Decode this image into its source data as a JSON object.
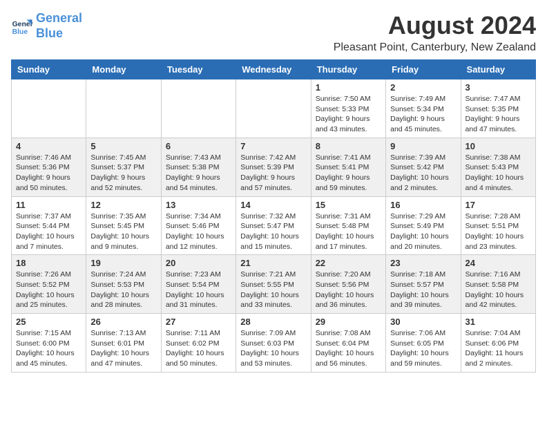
{
  "header": {
    "logo_line1": "General",
    "logo_line2": "Blue",
    "month_year": "August 2024",
    "location": "Pleasant Point, Canterbury, New Zealand"
  },
  "weekdays": [
    "Sunday",
    "Monday",
    "Tuesday",
    "Wednesday",
    "Thursday",
    "Friday",
    "Saturday"
  ],
  "weeks": [
    [
      {
        "day": "",
        "info": ""
      },
      {
        "day": "",
        "info": ""
      },
      {
        "day": "",
        "info": ""
      },
      {
        "day": "",
        "info": ""
      },
      {
        "day": "1",
        "info": "Sunrise: 7:50 AM\nSunset: 5:33 PM\nDaylight: 9 hours\nand 43 minutes."
      },
      {
        "day": "2",
        "info": "Sunrise: 7:49 AM\nSunset: 5:34 PM\nDaylight: 9 hours\nand 45 minutes."
      },
      {
        "day": "3",
        "info": "Sunrise: 7:47 AM\nSunset: 5:35 PM\nDaylight: 9 hours\nand 47 minutes."
      }
    ],
    [
      {
        "day": "4",
        "info": "Sunrise: 7:46 AM\nSunset: 5:36 PM\nDaylight: 9 hours\nand 50 minutes."
      },
      {
        "day": "5",
        "info": "Sunrise: 7:45 AM\nSunset: 5:37 PM\nDaylight: 9 hours\nand 52 minutes."
      },
      {
        "day": "6",
        "info": "Sunrise: 7:43 AM\nSunset: 5:38 PM\nDaylight: 9 hours\nand 54 minutes."
      },
      {
        "day": "7",
        "info": "Sunrise: 7:42 AM\nSunset: 5:39 PM\nDaylight: 9 hours\nand 57 minutes."
      },
      {
        "day": "8",
        "info": "Sunrise: 7:41 AM\nSunset: 5:41 PM\nDaylight: 9 hours\nand 59 minutes."
      },
      {
        "day": "9",
        "info": "Sunrise: 7:39 AM\nSunset: 5:42 PM\nDaylight: 10 hours\nand 2 minutes."
      },
      {
        "day": "10",
        "info": "Sunrise: 7:38 AM\nSunset: 5:43 PM\nDaylight: 10 hours\nand 4 minutes."
      }
    ],
    [
      {
        "day": "11",
        "info": "Sunrise: 7:37 AM\nSunset: 5:44 PM\nDaylight: 10 hours\nand 7 minutes."
      },
      {
        "day": "12",
        "info": "Sunrise: 7:35 AM\nSunset: 5:45 PM\nDaylight: 10 hours\nand 9 minutes."
      },
      {
        "day": "13",
        "info": "Sunrise: 7:34 AM\nSunset: 5:46 PM\nDaylight: 10 hours\nand 12 minutes."
      },
      {
        "day": "14",
        "info": "Sunrise: 7:32 AM\nSunset: 5:47 PM\nDaylight: 10 hours\nand 15 minutes."
      },
      {
        "day": "15",
        "info": "Sunrise: 7:31 AM\nSunset: 5:48 PM\nDaylight: 10 hours\nand 17 minutes."
      },
      {
        "day": "16",
        "info": "Sunrise: 7:29 AM\nSunset: 5:49 PM\nDaylight: 10 hours\nand 20 minutes."
      },
      {
        "day": "17",
        "info": "Sunrise: 7:28 AM\nSunset: 5:51 PM\nDaylight: 10 hours\nand 23 minutes."
      }
    ],
    [
      {
        "day": "18",
        "info": "Sunrise: 7:26 AM\nSunset: 5:52 PM\nDaylight: 10 hours\nand 25 minutes."
      },
      {
        "day": "19",
        "info": "Sunrise: 7:24 AM\nSunset: 5:53 PM\nDaylight: 10 hours\nand 28 minutes."
      },
      {
        "day": "20",
        "info": "Sunrise: 7:23 AM\nSunset: 5:54 PM\nDaylight: 10 hours\nand 31 minutes."
      },
      {
        "day": "21",
        "info": "Sunrise: 7:21 AM\nSunset: 5:55 PM\nDaylight: 10 hours\nand 33 minutes."
      },
      {
        "day": "22",
        "info": "Sunrise: 7:20 AM\nSunset: 5:56 PM\nDaylight: 10 hours\nand 36 minutes."
      },
      {
        "day": "23",
        "info": "Sunrise: 7:18 AM\nSunset: 5:57 PM\nDaylight: 10 hours\nand 39 minutes."
      },
      {
        "day": "24",
        "info": "Sunrise: 7:16 AM\nSunset: 5:58 PM\nDaylight: 10 hours\nand 42 minutes."
      }
    ],
    [
      {
        "day": "25",
        "info": "Sunrise: 7:15 AM\nSunset: 6:00 PM\nDaylight: 10 hours\nand 45 minutes."
      },
      {
        "day": "26",
        "info": "Sunrise: 7:13 AM\nSunset: 6:01 PM\nDaylight: 10 hours\nand 47 minutes."
      },
      {
        "day": "27",
        "info": "Sunrise: 7:11 AM\nSunset: 6:02 PM\nDaylight: 10 hours\nand 50 minutes."
      },
      {
        "day": "28",
        "info": "Sunrise: 7:09 AM\nSunset: 6:03 PM\nDaylight: 10 hours\nand 53 minutes."
      },
      {
        "day": "29",
        "info": "Sunrise: 7:08 AM\nSunset: 6:04 PM\nDaylight: 10 hours\nand 56 minutes."
      },
      {
        "day": "30",
        "info": "Sunrise: 7:06 AM\nSunset: 6:05 PM\nDaylight: 10 hours\nand 59 minutes."
      },
      {
        "day": "31",
        "info": "Sunrise: 7:04 AM\nSunset: 6:06 PM\nDaylight: 11 hours\nand 2 minutes."
      }
    ]
  ]
}
